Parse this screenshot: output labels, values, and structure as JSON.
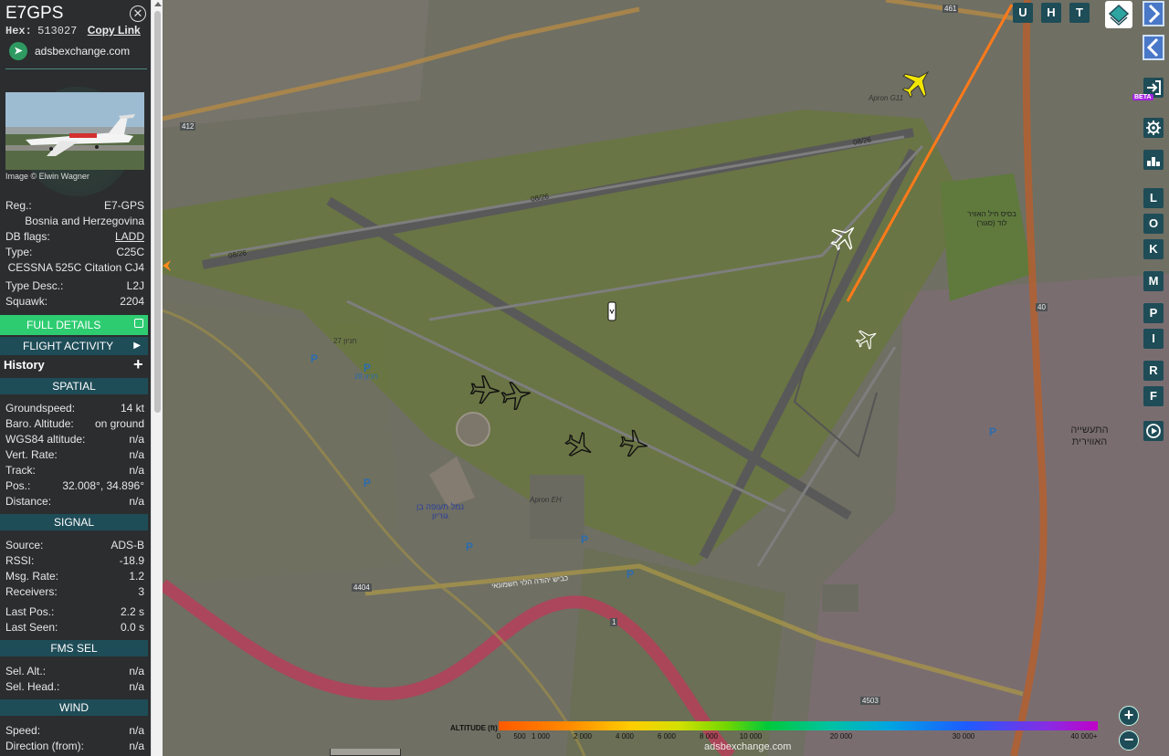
{
  "aircraft": {
    "callsign": "E7GPS",
    "hex_label": "Hex:",
    "hex": "513027",
    "copy_link": "Copy Link",
    "site": "adsbexchange.com",
    "image_credit": "Image © Elwin Wagner"
  },
  "details": {
    "reg_label": "Reg.:",
    "reg": "E7-GPS",
    "country": "Bosnia and Herzegovina",
    "db_flags_label": "DB flags:",
    "db_flags": "LADD",
    "type_label": "Type:",
    "type": "C25C",
    "type_full": "CESSNA 525C Citation CJ4",
    "type_desc_label": "Type Desc.:",
    "type_desc": "L2J",
    "squawk_label": "Squawk:",
    "squawk": "2204"
  },
  "buttons": {
    "full_details": "FULL DETAILS",
    "flight_activity": "FLIGHT ACTIVITY",
    "history": "History"
  },
  "spatial": {
    "title": "SPATIAL",
    "groundspeed_label": "Groundspeed:",
    "groundspeed": "14 kt",
    "baro_label": "Baro. Altitude:",
    "baro": "on ground",
    "wgs_label": "WGS84 altitude:",
    "wgs": "n/a",
    "vert_label": "Vert. Rate:",
    "vert": "n/a",
    "track_label": "Track:",
    "track": "n/a",
    "pos_label": "Pos.:",
    "pos": "32.008°, 34.896°",
    "distance_label": "Distance:",
    "distance": "n/a"
  },
  "signal": {
    "title": "SIGNAL",
    "source_label": "Source:",
    "source": "ADS-B",
    "rssi_label": "RSSI:",
    "rssi": "-18.9",
    "msg_label": "Msg. Rate:",
    "msg": "1.2",
    "receivers_label": "Receivers:",
    "receivers": "3",
    "lastpos_label": "Last Pos.:",
    "lastpos": "2.2 s",
    "lastseen_label": "Last Seen:",
    "lastseen": "0.0 s"
  },
  "fms": {
    "title": "FMS SEL",
    "selalt_label": "Sel. Alt.:",
    "selalt": "n/a",
    "selhead_label": "Sel. Head.:",
    "selhead": "n/a"
  },
  "wind": {
    "title": "WIND",
    "speed_label": "Speed:",
    "speed": "n/a",
    "dir_label": "Direction (from):",
    "dir": "n/a"
  },
  "map": {
    "top_buttons": [
      "U",
      "H",
      "T"
    ],
    "side_buttons": [
      "L",
      "O",
      "K",
      "M",
      "P",
      "I",
      "R",
      "F"
    ],
    "beta": "BETA",
    "labels": {
      "apron_g11": "Apron G11",
      "apron_eh": "Apron EH",
      "rwy_0826_a": "08/26",
      "rwy_0826_b": "08/26",
      "rwy_0826_c": "08/26",
      "road_412": "412",
      "road_461": "461",
      "road_4404": "4404",
      "road_4503": "4503",
      "road_40": "40",
      "road_1": "1",
      "gate_27": "חניון 27",
      "gate_28": "חניון 28",
      "airport_he": "נמל תעופה בן גוריון",
      "industry_he": "התעשייה האווירית",
      "base_he": "בסיס חיל האוויר לוד (סגור)",
      "highway_he": "כביש יהודה הלוי חשמונאי"
    },
    "legend": {
      "title": "ALTITUDE (ft)",
      "ticks": [
        "0",
        "500",
        "1 000",
        "2 000",
        "4 000",
        "6 000",
        "8 000",
        "10 000",
        "20 000",
        "30 000",
        "40 000+"
      ]
    },
    "attribution": "adsbexchange.com",
    "colors": {
      "selected_aircraft": "#f2e600",
      "track_line": "#ff7a1a",
      "runway": "#5d5d5d",
      "sidebar_section": "#1e4c57",
      "full_details": "#2ecc71"
    }
  }
}
